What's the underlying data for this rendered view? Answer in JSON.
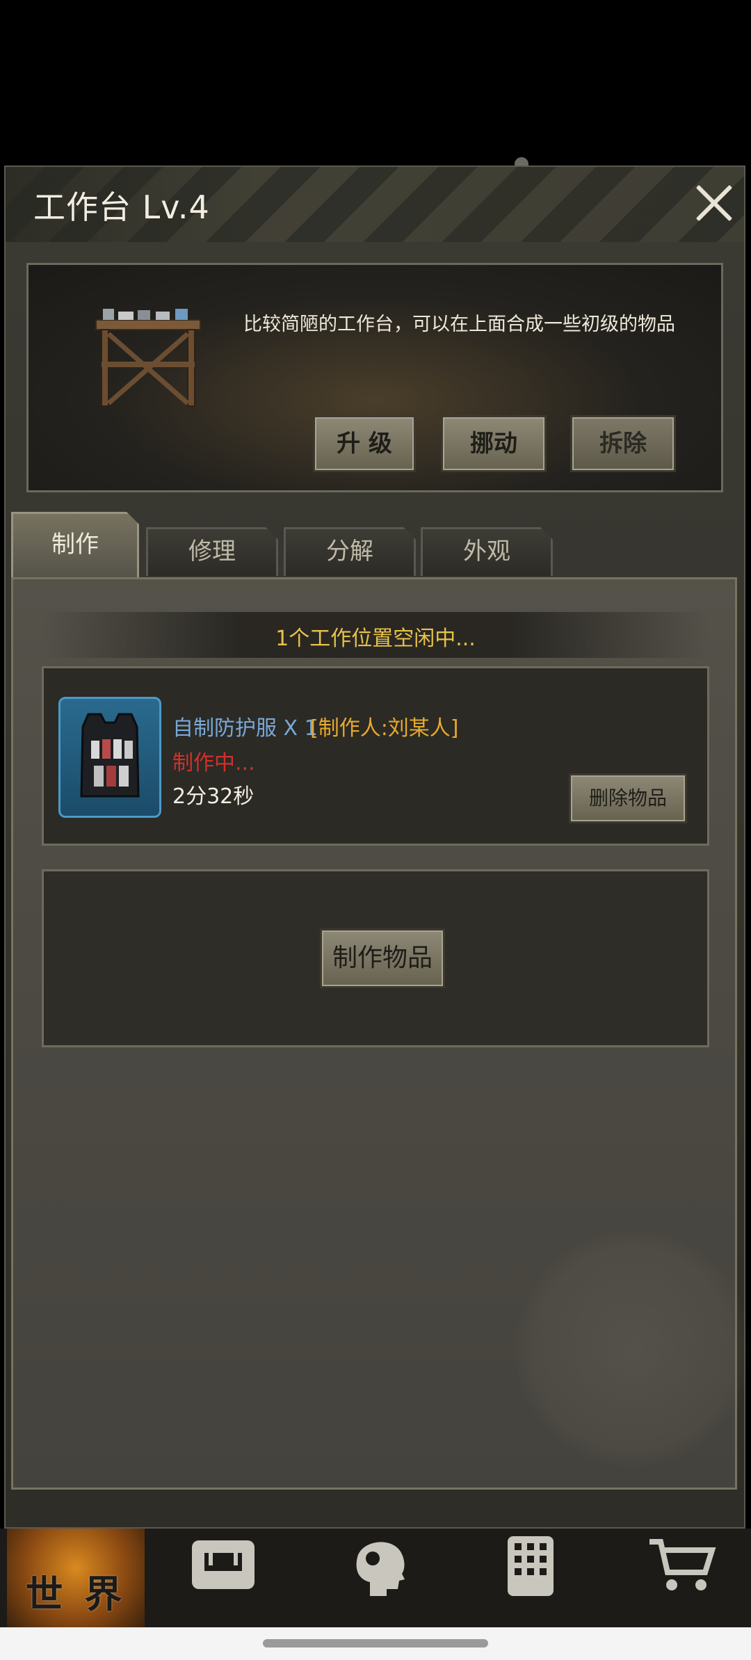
{
  "header": {
    "title": "工作台 Lv.4"
  },
  "info": {
    "description": "比较简陋的工作台，可以在上面合成一些初级的物品",
    "buttons": {
      "upgrade": "升 级",
      "move": "挪动",
      "dismantle": "拆除"
    }
  },
  "tabs": [
    {
      "label": "制作",
      "active": true
    },
    {
      "label": "修理",
      "active": false
    },
    {
      "label": "分解",
      "active": false
    },
    {
      "label": "外观",
      "active": false
    }
  ],
  "craft": {
    "idle_status": "1个工作位置空闲中...",
    "job": {
      "item_name": "自制防护服 X 1",
      "crafter": "[制作人:刘某人]",
      "status": "制作中...",
      "time_left": "2分32秒",
      "delete_label": "删除物品"
    },
    "empty_slot": {
      "button_label": "制作物品"
    }
  },
  "bottom_nav": {
    "world_label": "世 界",
    "icons": [
      "backpack-icon",
      "character-head-icon",
      "building-icon",
      "shopping-cart-icon"
    ]
  },
  "colors": {
    "idle_text": "#e8c24a",
    "item_name": "#7aa8d8",
    "crafter": "#e8a92c",
    "status_crafting": "#d2302b"
  }
}
